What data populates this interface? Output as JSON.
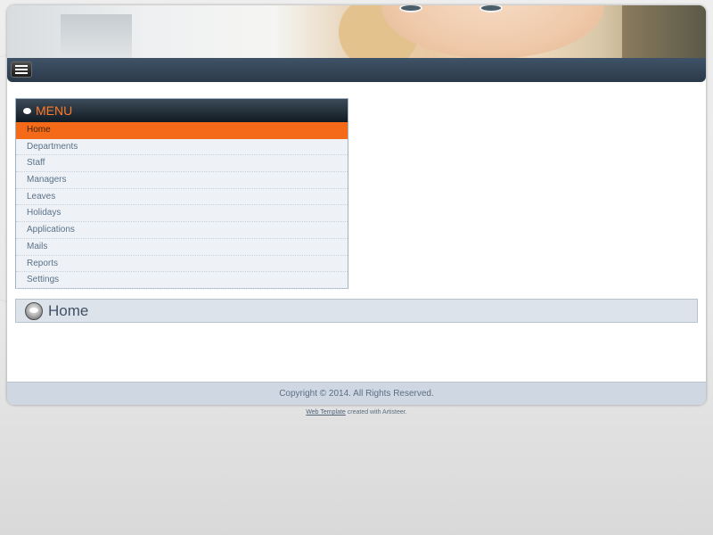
{
  "nav": {
    "menu_icon": "hamburger-menu-icon"
  },
  "vmenu": {
    "title": "MENU",
    "items": [
      {
        "label": "Home",
        "active": true
      },
      {
        "label": "Departments"
      },
      {
        "label": "Staff"
      },
      {
        "label": "Managers"
      },
      {
        "label": "Leaves"
      },
      {
        "label": "Holidays"
      },
      {
        "label": "Applications"
      },
      {
        "label": "Mails"
      },
      {
        "label": "Reports"
      },
      {
        "label": "Settings"
      }
    ]
  },
  "post": {
    "title": "Home",
    "icon": "post-bullet-icon"
  },
  "footer": {
    "copyright": "Copyright © 2014. All Rights Reserved."
  },
  "credits": {
    "link_text": "Web Template",
    "suffix": " created with Artisteer."
  },
  "colors": {
    "accent": "#f56a18",
    "menu_title": "#ff7a2a",
    "nav_bar": "#2f3f50"
  }
}
